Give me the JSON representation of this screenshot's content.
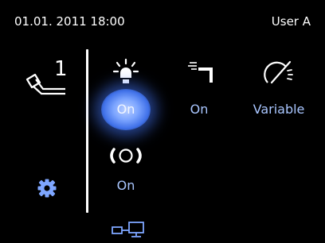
{
  "header": {
    "datetime": "01.01. 2011 18:00",
    "user": "User A"
  },
  "instrument": {
    "number": "1",
    "icon": "handpiece-icon"
  },
  "settings": {
    "icon": "gear-icon"
  },
  "controls": {
    "light": {
      "icon": "light-bulb-icon",
      "status": "On"
    },
    "spray": {
      "icon": "spray-nozzle-icon",
      "status": "On"
    },
    "speed": {
      "icon": "speed-gauge-icon",
      "status": "Variable"
    },
    "vibration": {
      "icon": "vibration-icon",
      "status": "On"
    }
  },
  "footer": {
    "icon": "monitor-connection-icon"
  },
  "colors": {
    "accent": "#7ea6ff",
    "background": "#000000"
  }
}
